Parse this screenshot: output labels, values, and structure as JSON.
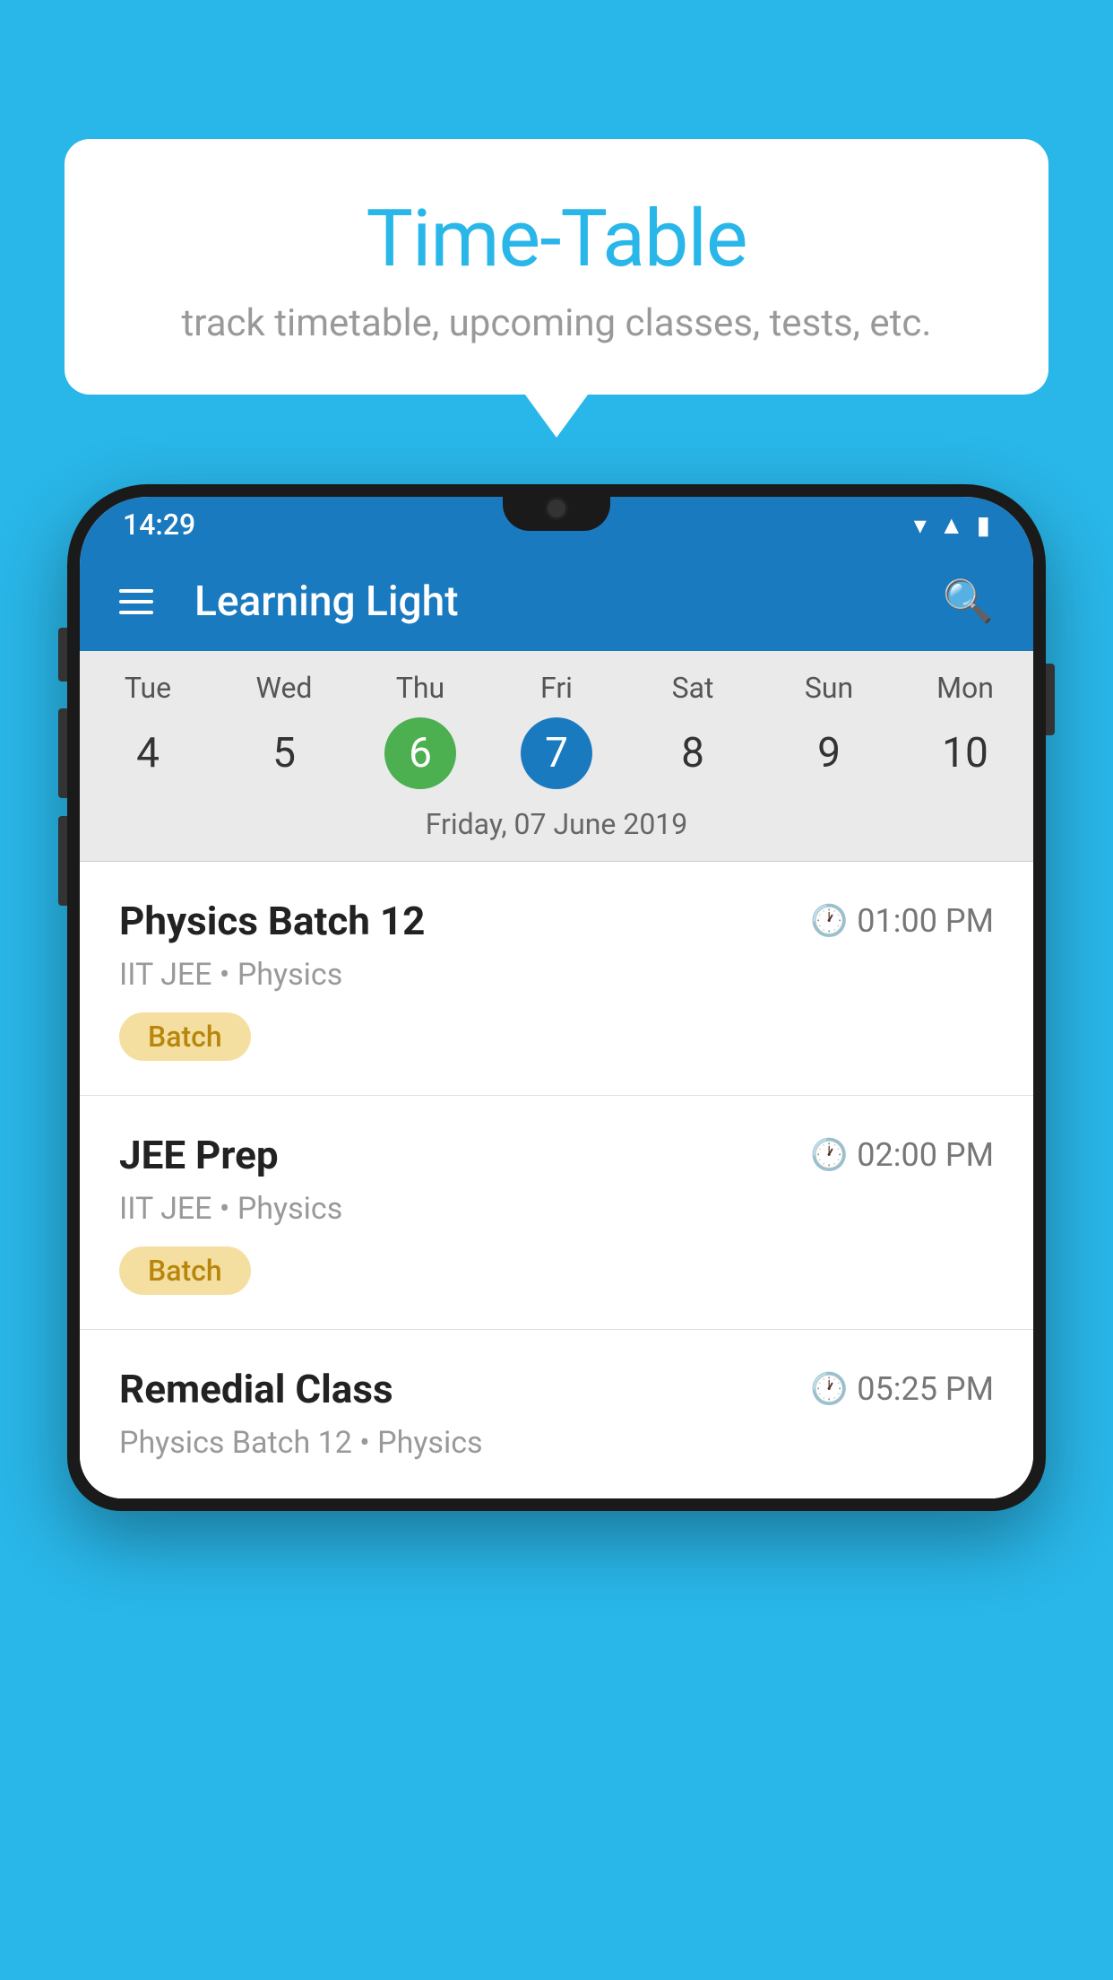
{
  "background_color": "#29b6e8",
  "bubble": {
    "title": "Time-Table",
    "subtitle": "track timetable, upcoming classes, tests, etc."
  },
  "status_bar": {
    "time": "14:29"
  },
  "app_bar": {
    "title": "Learning Light"
  },
  "calendar": {
    "days": [
      {
        "name": "Tue",
        "num": "4",
        "state": "normal"
      },
      {
        "name": "Wed",
        "num": "5",
        "state": "normal"
      },
      {
        "name": "Thu",
        "num": "6",
        "state": "today"
      },
      {
        "name": "Fri",
        "num": "7",
        "state": "selected"
      },
      {
        "name": "Sat",
        "num": "8",
        "state": "normal"
      },
      {
        "name": "Sun",
        "num": "9",
        "state": "normal"
      },
      {
        "name": "Mon",
        "num": "10",
        "state": "normal"
      }
    ],
    "selected_date_label": "Friday, 07 June 2019"
  },
  "schedule": {
    "items": [
      {
        "title": "Physics Batch 12",
        "time": "01:00 PM",
        "subtitle": "IIT JEE • Physics",
        "badge": "Batch"
      },
      {
        "title": "JEE Prep",
        "time": "02:00 PM",
        "subtitle": "IIT JEE • Physics",
        "badge": "Batch"
      },
      {
        "title": "Remedial Class",
        "time": "05:25 PM",
        "subtitle": "Physics Batch 12 • Physics",
        "badge": null
      }
    ]
  }
}
